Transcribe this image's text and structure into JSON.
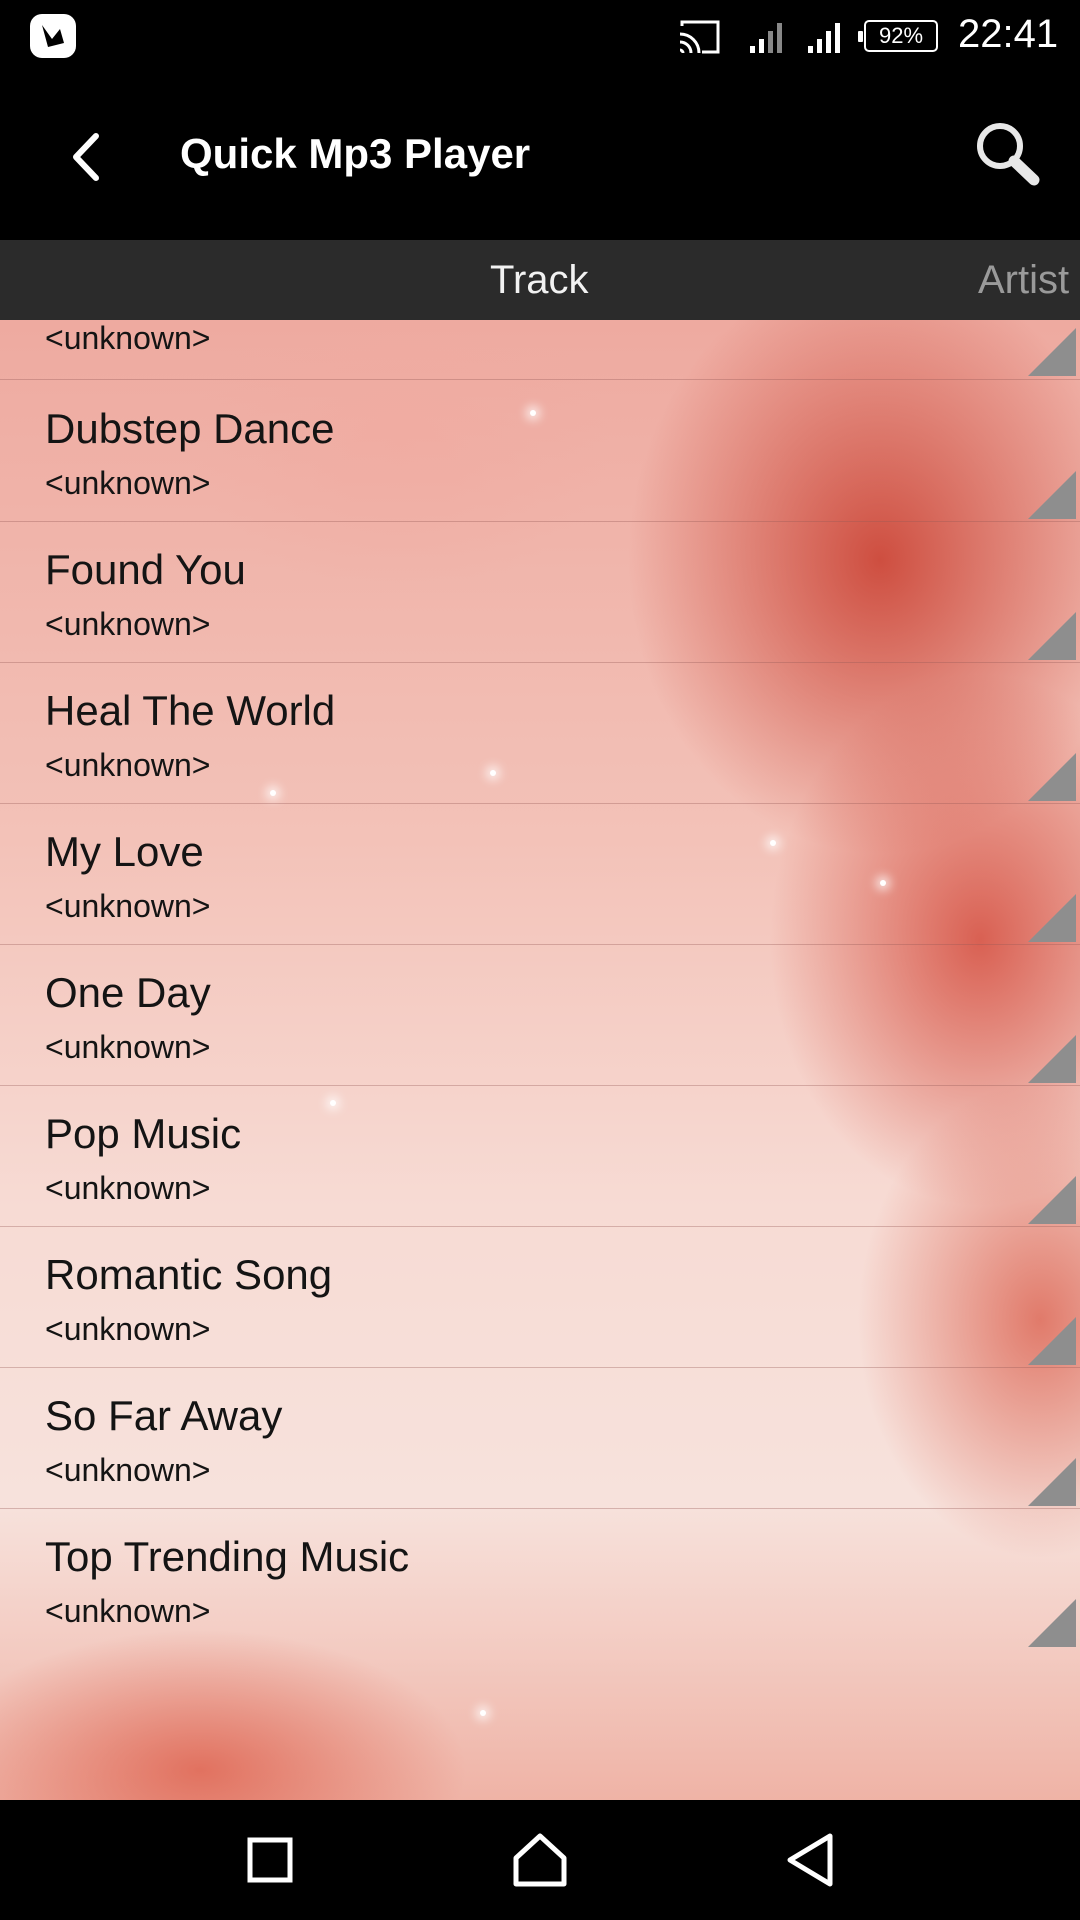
{
  "status_bar": {
    "battery": "92%",
    "time": "22:41",
    "icons": [
      "app-notification-icon",
      "cast-icon",
      "signal-icon",
      "signal-icon",
      "battery-icon"
    ]
  },
  "app_bar": {
    "title": "Quick Mp3 Player",
    "back_icon": "chevron-left-icon",
    "search_icon": "search-icon"
  },
  "tabs": [
    {
      "label": "Track",
      "selected": true
    },
    {
      "label": "Artist",
      "selected": false
    }
  ],
  "tracks": [
    {
      "title": "",
      "artist": "<unknown>"
    },
    {
      "title": "Dubstep Dance",
      "artist": "<unknown>"
    },
    {
      "title": "Found You",
      "artist": "<unknown>"
    },
    {
      "title": "Heal The World",
      "artist": "<unknown>"
    },
    {
      "title": "My Love",
      "artist": "<unknown>"
    },
    {
      "title": "One Day",
      "artist": "<unknown>"
    },
    {
      "title": "Pop Music",
      "artist": "<unknown>"
    },
    {
      "title": "Romantic Song",
      "artist": "<unknown>"
    },
    {
      "title": "So Far Away",
      "artist": "<unknown>"
    },
    {
      "title": "Top Trending Music",
      "artist": "<unknown>"
    }
  ],
  "nav_bar": {
    "icons": [
      "recents-icon",
      "home-icon",
      "back-icon"
    ]
  },
  "colors": {
    "bar_background": "#000000",
    "tab_background": "#2b2b2b",
    "tab_selected_text": "#f2f2f2",
    "tab_unselected_text": "#9a9a9a",
    "row_menu_triangle": "#8e8e8e"
  }
}
